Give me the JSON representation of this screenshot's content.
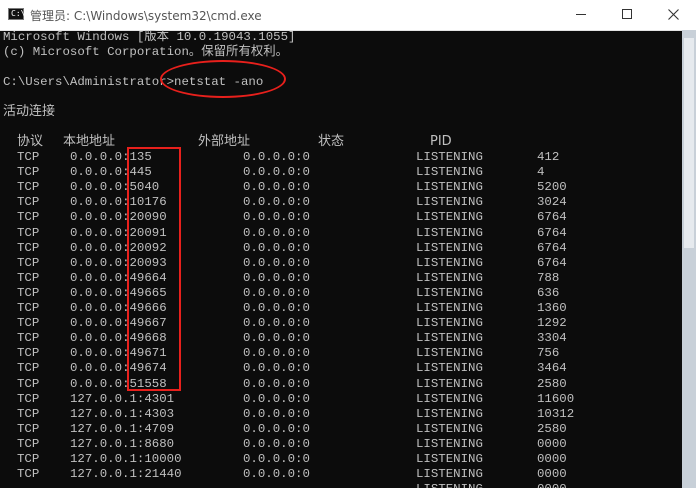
{
  "window": {
    "title": "管理员: C:\\Windows\\system32\\cmd.exe",
    "icon": "cmd-icon",
    "icon_glyph": "C:\\",
    "controls": [
      "minimize-icon",
      "maximize-icon",
      "close-icon"
    ]
  },
  "console": {
    "banner_line1": "Microsoft Windows [版本 10.0.19043.1055]",
    "banner_line2": "(c) Microsoft Corporation。保留所有权利。",
    "prompt": "C:\\Users\\Administrator>",
    "command": "netstat -ano",
    "section_title": "活动连接",
    "headers": {
      "proto": "协议",
      "local": "本地地址",
      "foreign": "外部地址",
      "state": "状态",
      "pid": "PID"
    },
    "rows": [
      {
        "proto": "TCP",
        "local_ip": "0.0.0.0",
        "port": "135",
        "foreign": "0.0.0.0:0",
        "state": "LISTENING",
        "pid": "412"
      },
      {
        "proto": "TCP",
        "local_ip": "0.0.0.0",
        "port": "445",
        "foreign": "0.0.0.0:0",
        "state": "LISTENING",
        "pid": "4"
      },
      {
        "proto": "TCP",
        "local_ip": "0.0.0.0",
        "port": "5040",
        "foreign": "0.0.0.0:0",
        "state": "LISTENING",
        "pid": "5200"
      },
      {
        "proto": "TCP",
        "local_ip": "0.0.0.0",
        "port": "10176",
        "foreign": "0.0.0.0:0",
        "state": "LISTENING",
        "pid": "3024"
      },
      {
        "proto": "TCP",
        "local_ip": "0.0.0.0",
        "port": "20090",
        "foreign": "0.0.0.0:0",
        "state": "LISTENING",
        "pid": "6764"
      },
      {
        "proto": "TCP",
        "local_ip": "0.0.0.0",
        "port": "20091",
        "foreign": "0.0.0.0:0",
        "state": "LISTENING",
        "pid": "6764"
      },
      {
        "proto": "TCP",
        "local_ip": "0.0.0.0",
        "port": "20092",
        "foreign": "0.0.0.0:0",
        "state": "LISTENING",
        "pid": "6764"
      },
      {
        "proto": "TCP",
        "local_ip": "0.0.0.0",
        "port": "20093",
        "foreign": "0.0.0.0:0",
        "state": "LISTENING",
        "pid": "6764"
      },
      {
        "proto": "TCP",
        "local_ip": "0.0.0.0",
        "port": "49664",
        "foreign": "0.0.0.0:0",
        "state": "LISTENING",
        "pid": "788"
      },
      {
        "proto": "TCP",
        "local_ip": "0.0.0.0",
        "port": "49665",
        "foreign": "0.0.0.0:0",
        "state": "LISTENING",
        "pid": "636"
      },
      {
        "proto": "TCP",
        "local_ip": "0.0.0.0",
        "port": "49666",
        "foreign": "0.0.0.0:0",
        "state": "LISTENING",
        "pid": "1360"
      },
      {
        "proto": "TCP",
        "local_ip": "0.0.0.0",
        "port": "49667",
        "foreign": "0.0.0.0:0",
        "state": "LISTENING",
        "pid": "1292"
      },
      {
        "proto": "TCP",
        "local_ip": "0.0.0.0",
        "port": "49668",
        "foreign": "0.0.0.0:0",
        "state": "LISTENING",
        "pid": "3304"
      },
      {
        "proto": "TCP",
        "local_ip": "0.0.0.0",
        "port": "49671",
        "foreign": "0.0.0.0:0",
        "state": "LISTENING",
        "pid": "756"
      },
      {
        "proto": "TCP",
        "local_ip": "0.0.0.0",
        "port": "49674",
        "foreign": "0.0.0.0:0",
        "state": "LISTENING",
        "pid": "3464"
      },
      {
        "proto": "TCP",
        "local_ip": "0.0.0.0",
        "port": "51558",
        "foreign": "0.0.0.0:0",
        "state": "LISTENING",
        "pid": "2580"
      },
      {
        "proto": "TCP",
        "local_ip": "127.0.0.1",
        "port": "4301",
        "foreign": "0.0.0.0:0",
        "state": "LISTENING",
        "pid": "11600"
      },
      {
        "proto": "TCP",
        "local_ip": "127.0.0.1",
        "port": "4303",
        "foreign": "0.0.0.0:0",
        "state": "LISTENING",
        "pid": "10312"
      },
      {
        "proto": "TCP",
        "local_ip": "127.0.0.1",
        "port": "4709",
        "foreign": "0.0.0.0:0",
        "state": "LISTENING",
        "pid": "2580"
      },
      {
        "proto": "TCP",
        "local_ip": "127.0.0.1",
        "port": "8680",
        "foreign": "0.0.0.0:0",
        "state": "LISTENING",
        "pid": "0000"
      },
      {
        "proto": "TCP",
        "local_ip": "127.0.0.1",
        "port": "10000",
        "foreign": "0.0.0.0:0",
        "state": "LISTENING",
        "pid": "0000"
      },
      {
        "proto": "TCP",
        "local_ip": "127.0.0.1",
        "port": "21440",
        "foreign": "0.0.0.0:0",
        "state": "LISTENING",
        "pid": "0000"
      },
      {
        "proto": "",
        "local_ip": "",
        "port": "",
        "foreign": "",
        "state": "LISTENING",
        "pid": "0000"
      }
    ]
  },
  "colors": {
    "console_bg": "#0c0c0c",
    "console_text": "#c0c0c0",
    "annotation_red": "#e8201c"
  }
}
